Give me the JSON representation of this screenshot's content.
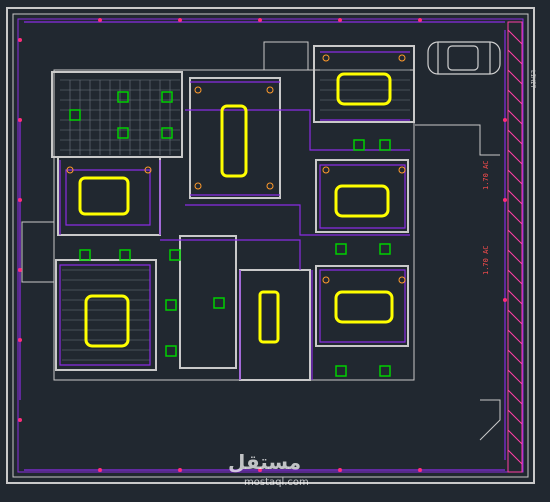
{
  "drawing": {
    "dimension_labels": [
      "1.70 AC",
      "1.70 AC"
    ],
    "side_label": "LIMIT"
  },
  "watermark": {
    "text": "مستقل",
    "subtext": "mostaql.com"
  },
  "colors": {
    "background": "#212830",
    "walls": "#c8c8c8",
    "electrical": "#8a2be2",
    "fixtures": "#ffff00",
    "lights": "#00d000",
    "markers": "#ff2d7a",
    "hatch": "#ff3ea5"
  }
}
